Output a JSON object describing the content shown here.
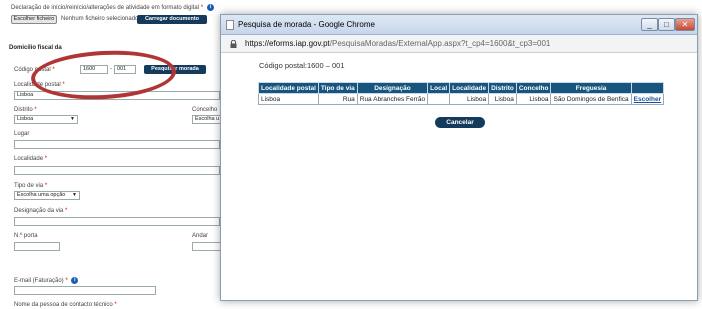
{
  "form": {
    "declaration_label": "Declaração de início/reinício/alterações de atividade em formato digital",
    "required_mark": "*",
    "choose_file_label": "Escolher ficheiro",
    "no_file_label": "Nenhum ficheiro selecionado",
    "upload_label": "Carregar documento",
    "fiscal_section_title": "Domicílio fiscal da",
    "postal_code_label": "Código postal",
    "postal_code_part1": "1600",
    "postal_code_sep": "-",
    "postal_code_part2": "001",
    "search_address_label": "Pesquisar morada",
    "localidade_postal_label": "Localidade postal",
    "localidade_postal_value": "Lisboa",
    "distrito_label": "Distrito",
    "distrito_value": "Lisboa",
    "concelho_label": "Concelho",
    "concelho_value": "Escolha u",
    "lugar_label": "Lugar",
    "localidade_label": "Localidade",
    "tipo_via_label": "Tipo de via",
    "tipo_via_value": "Escolha uma opção",
    "designacao_via_label": "Designação da via",
    "porta_label": "N.º porta",
    "andar_label": "Andar",
    "email_label": "E-mail (Faturação)",
    "contact_name_label": "Nome da pessoa de contacto técnico"
  },
  "popup": {
    "window_title": "Pesquisa de morada - Google Chrome",
    "url_host": "https://eforms.iap.gov.pt",
    "url_path": "/PesquisaMoradas/ExternalApp.aspx?t_cp4=1600&t_cp3=001",
    "postal_line": "Código postal:1600 – 001",
    "columns": [
      "Localidade postal",
      "Tipo de via",
      "Designação",
      "Local",
      "Localidade",
      "Distrito",
      "Concelho",
      "Freguesia",
      ""
    ],
    "rows": [
      [
        "Lisboa",
        "Rua",
        "Rua Abranches Ferrão",
        "",
        "Lisboa",
        "Lisboa",
        "Lisboa",
        "São Domingos de Benfica",
        "Escolher"
      ]
    ],
    "cancel_label": "Cancelar"
  },
  "colors": {
    "accent_dark": "#143a5c",
    "table_header": "#17557f",
    "required": "#cc0000",
    "annotation_ring": "#b03535"
  }
}
